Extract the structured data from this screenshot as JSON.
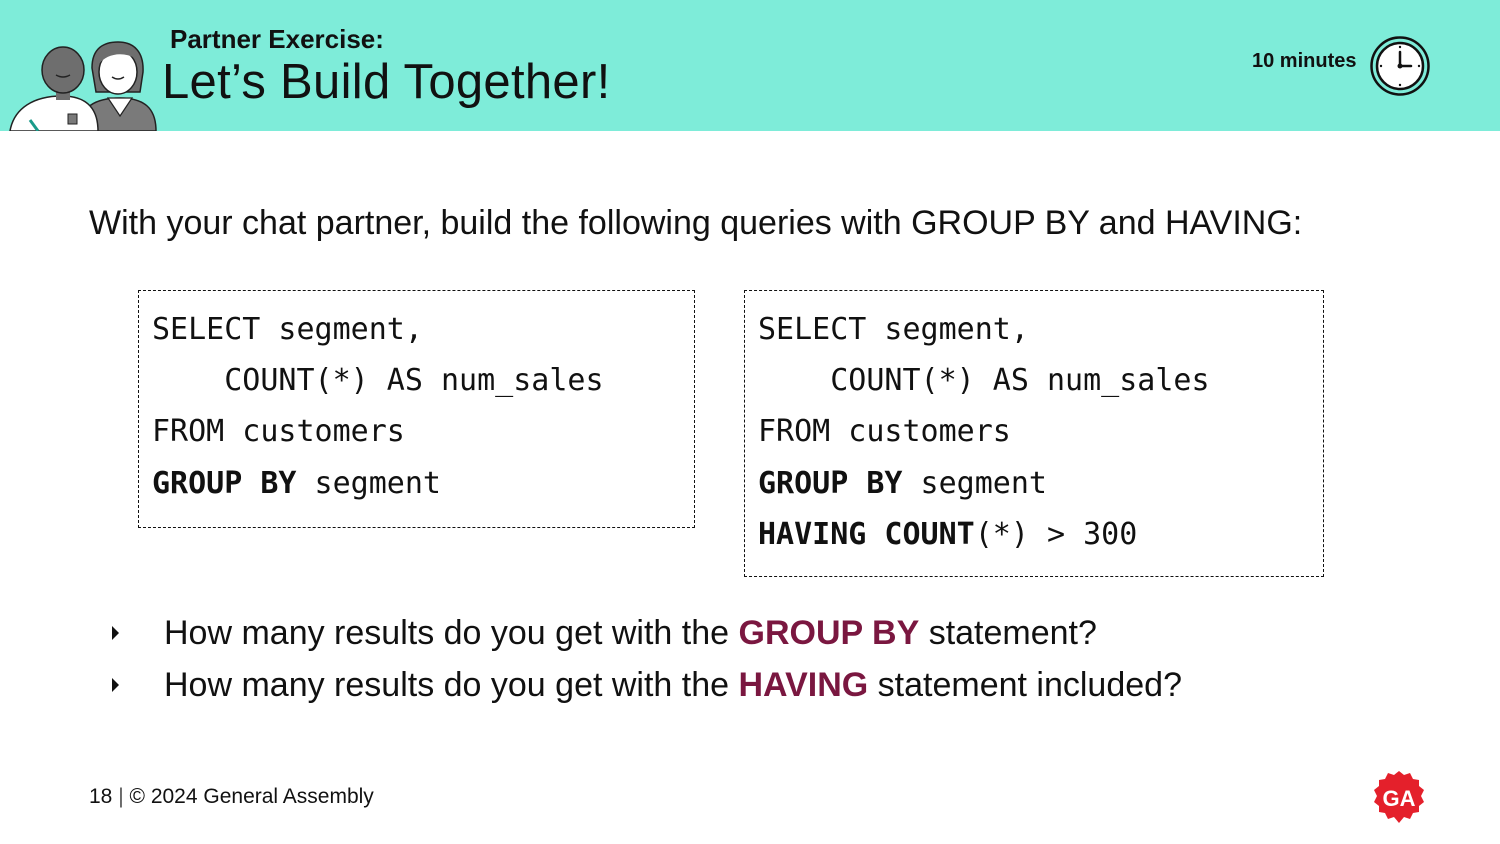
{
  "header": {
    "kicker": "Partner Exercise:",
    "title": "Let’s Build Together!",
    "duration": "10 minutes",
    "background_color": "#7eecd9",
    "illustration_icon": "two-people-icon",
    "timer_icon": "clock-icon"
  },
  "intro": "With your chat partner, build the following queries with GROUP BY and HAVING:",
  "code_blocks": [
    {
      "lines": [
        {
          "kw": "",
          "text": "SELECT segment,"
        },
        {
          "kw": "",
          "text": "    COUNT(*) AS num_sales"
        },
        {
          "kw": "",
          "text": "FROM customers"
        },
        {
          "kw": "GROUP BY",
          "text": " segment"
        }
      ]
    },
    {
      "lines": [
        {
          "kw": "",
          "text": "SELECT segment,"
        },
        {
          "kw": "",
          "text": "    COUNT(*) AS num_sales"
        },
        {
          "kw": "",
          "text": "FROM customers"
        },
        {
          "kw": "GROUP BY",
          "text": " segment"
        },
        {
          "kw": "HAVING COUNT",
          "text": "(*) > 300"
        }
      ]
    }
  ],
  "questions": [
    {
      "before": "How many results do you get with the ",
      "highlight": "GROUP BY",
      "after": " statement?"
    },
    {
      "before": "How many results do you get with the ",
      "highlight": "HAVING",
      "after": " statement included?"
    }
  ],
  "highlight_color": "#7a1740",
  "footer": {
    "page_number": "18",
    "separator": "|",
    "copyright": "© 2024 General Assembly",
    "logo_text": "GA",
    "logo_color": "#e4202b"
  }
}
